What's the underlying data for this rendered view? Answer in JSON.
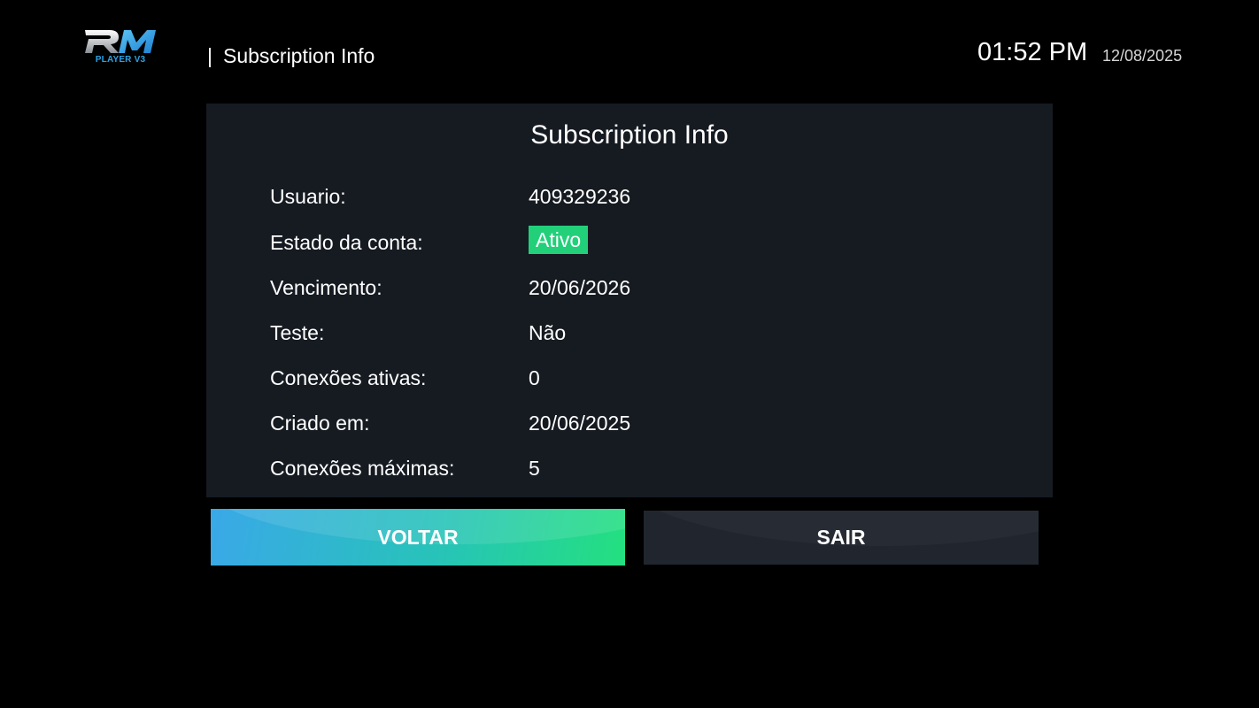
{
  "header": {
    "logo_text": "PLAYER V3",
    "separator": "|",
    "title": "Subscription Info",
    "time": "01:52 PM",
    "date": "12/08/2025"
  },
  "panel": {
    "title": "Subscription Info",
    "rows": [
      {
        "label": "Usuario:",
        "value": "409329236"
      },
      {
        "label": "Estado da conta:",
        "value": "Ativo"
      },
      {
        "label": "Vencimento:",
        "value": "20/06/2026"
      },
      {
        "label": "Teste:",
        "value": "Não"
      },
      {
        "label": "Conexões ativas:",
        "value": "0"
      },
      {
        "label": "Criado em:",
        "value": "20/06/2025"
      },
      {
        "label": "Conexões máximas:",
        "value": "5"
      }
    ]
  },
  "buttons": {
    "back_label": "VOLTAR",
    "exit_label": "SAIR"
  },
  "colors": {
    "background": "#000000",
    "panel": "#161b22",
    "status_active": "#22d07a",
    "accent_blue": "#3aa8e8",
    "accent_green": "#24e07f"
  }
}
